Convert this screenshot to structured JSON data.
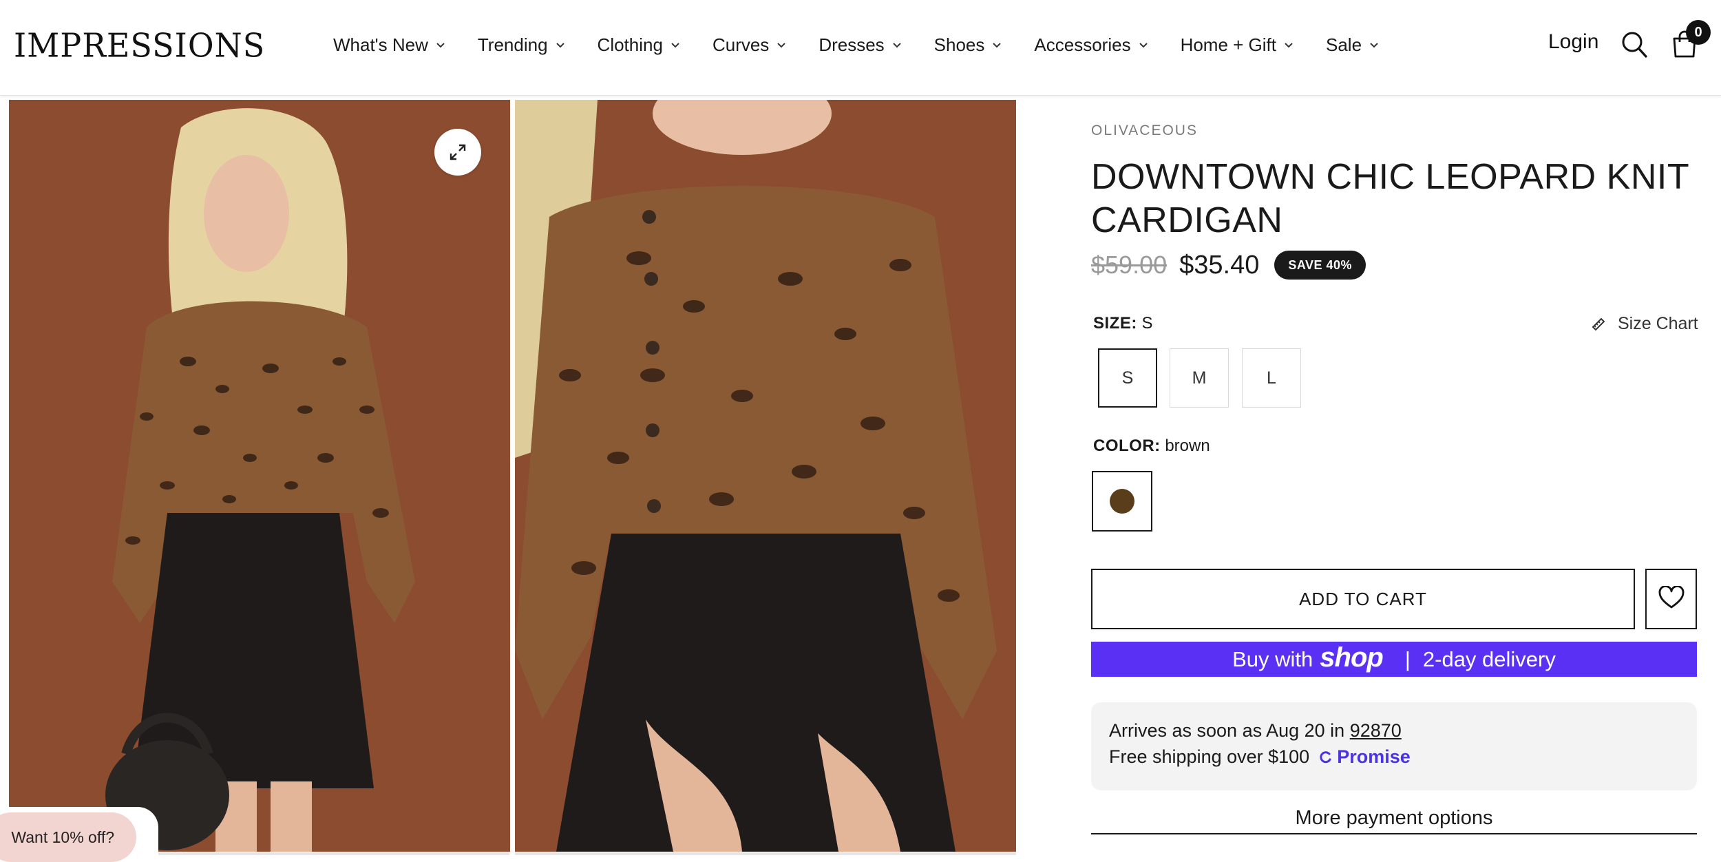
{
  "header": {
    "logo": "IMPRESSIONS",
    "nav": [
      {
        "label": "What's New"
      },
      {
        "label": "Trending"
      },
      {
        "label": "Clothing"
      },
      {
        "label": "Curves"
      },
      {
        "label": "Dresses"
      },
      {
        "label": "Shoes"
      },
      {
        "label": "Accessories"
      },
      {
        "label": "Home + Gift"
      },
      {
        "label": "Sale"
      }
    ],
    "login_label": "Login",
    "cart_count": "0"
  },
  "product": {
    "vendor": "OLIVACEOUS",
    "title": "DOWNTOWN CHIC LEOPARD KNIT CARDIGAN",
    "price_original": "$59.00",
    "price_sale": "$35.40",
    "save_badge": "SAVE 40%",
    "size": {
      "label": "SIZE:",
      "selected": "S",
      "options": [
        "S",
        "M",
        "L"
      ],
      "size_chart_label": "Size Chart"
    },
    "color": {
      "label": "COLOR:",
      "selected": "brown",
      "swatch_hex": "#5a3d1b"
    },
    "add_to_cart_label": "ADD TO CART",
    "shop_pay": {
      "prefix": "Buy with",
      "brand": "shop",
      "separator": "|",
      "suffix": "2-day delivery",
      "bg_color": "#5a31f4"
    },
    "delivery": {
      "arrives_prefix": "Arrives as soon as Aug 20 in",
      "zip": "92870",
      "free_shipping": "Free shipping over $100",
      "promise": "Promise"
    },
    "more_payment_label": "More payment options"
  },
  "promo": {
    "label": "Want 10% off?"
  },
  "colors": {
    "accent_dark": "#1a1a1a",
    "promo_pink": "#f2d4d0",
    "promise_blue": "#4a33e0"
  }
}
